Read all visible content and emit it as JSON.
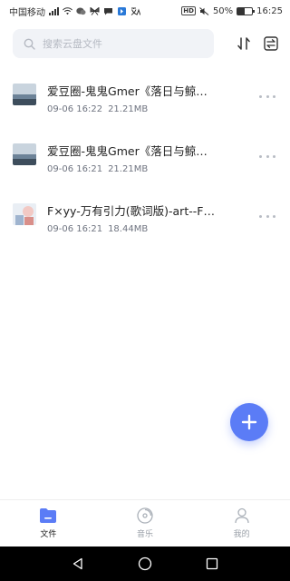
{
  "status_bar": {
    "carrier": "中国移动",
    "battery_percent": "50%",
    "battery_level": 0.5,
    "time": "16:25"
  },
  "search": {
    "placeholder": "搜索云盘文件"
  },
  "files": [
    {
      "name": "爱豆圈-鬼鬼Gmer《落日与鲸…",
      "date": "09-06 16:22",
      "size": "21.21MB"
    },
    {
      "name": "爱豆圈-鬼鬼Gmer《落日与鲸…",
      "date": "09-06 16:21",
      "size": "21.21MB"
    },
    {
      "name": "F×yy-万有引力(歌词版)-art--F×…",
      "date": "09-06 16:21",
      "size": "18.44MB"
    }
  ],
  "tabs": [
    {
      "label": "文件",
      "icon": "folder-icon",
      "active": true
    },
    {
      "label": "音乐",
      "icon": "disc-icon",
      "active": false
    },
    {
      "label": "我的",
      "icon": "person-icon",
      "active": false
    }
  ],
  "colors": {
    "accent": "#5b7cf6",
    "text_primary": "#222222",
    "text_secondary": "#6f7480"
  }
}
